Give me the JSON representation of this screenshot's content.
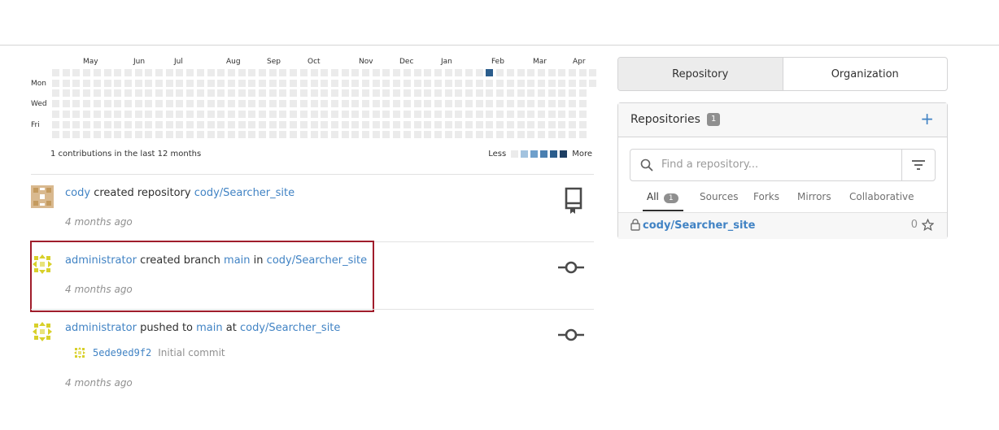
{
  "heatmap": {
    "months": [
      "May",
      "Jun",
      "Jul",
      "Aug",
      "Sep",
      "Oct",
      "Nov",
      "Dec",
      "Jan",
      "Feb",
      "Mar",
      "Apr"
    ],
    "days": [
      "Mon",
      "Wed",
      "Fri"
    ],
    "summary": "1 contributions in the last 12 months",
    "legend_less": "Less",
    "legend_more": "More",
    "legend_colors": [
      "#ebebeb",
      "#a3c3df",
      "#6fa0cb",
      "#4a7fb0",
      "#2b5d8c",
      "#1e3f63"
    ],
    "active_week": 42,
    "active_day": 0
  },
  "feed": [
    {
      "user": "cody",
      "action": "created repository",
      "repo": "cody/Searcher_site",
      "time": "4 months ago",
      "icon": "repo-icon"
    },
    {
      "user": "administrator",
      "action": "created branch",
      "branch": "main",
      "connector": "in",
      "repo": "cody/Searcher_site",
      "time": "4 months ago",
      "icon": "git-commit-icon"
    },
    {
      "user": "administrator",
      "action": "pushed to",
      "branch": "main",
      "connector": "at",
      "repo": "cody/Searcher_site",
      "commit_sha": "5ede9ed9f2",
      "commit_message": "Initial commit",
      "time": "4 months ago",
      "icon": "git-commit-icon"
    }
  ],
  "sidebar": {
    "tabs": [
      "Repository",
      "Organization"
    ],
    "title": "Repositories",
    "count": "1",
    "search_placeholder": "Find a repository...",
    "filters": [
      {
        "label": "All",
        "count": "1"
      },
      {
        "label": "Sources"
      },
      {
        "label": "Forks"
      },
      {
        "label": "Mirrors"
      },
      {
        "label": "Collaborative"
      }
    ],
    "repos": [
      {
        "name": "cody/Searcher_site",
        "stars": "0"
      }
    ]
  }
}
